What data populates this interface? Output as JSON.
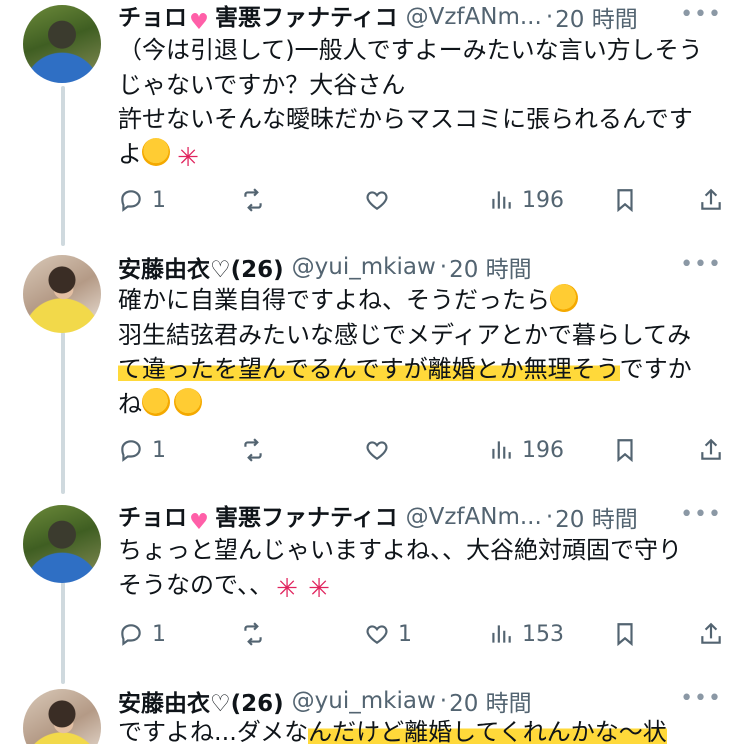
{
  "tweets": [
    {
      "name": "チョロ",
      "name_suffix": "害悪ファナティコ",
      "handle": "@VzfANm...",
      "time": "20 時間",
      "more": "•••",
      "lines": [
        "（今は引退して)一般人ですよーみたいな言い方しそう",
        "じゃないですか？大谷さん",
        "許せないそんな曖昧だからマスコミに張られるんです",
        "よ"
      ],
      "replies": "1",
      "retweets": "",
      "likes": "",
      "views": "196"
    },
    {
      "name": "安藤由衣♡(26)",
      "handle": "@yui_mkiaw",
      "time": "20 時間",
      "more": "•••",
      "line1": "確かに自業自得ですよね、そうだったら",
      "line2": "羽生結弦君みたいな感じでメディアとかで暮らしてみ",
      "line3_hl": "て違ったを望んでるんですが離婚とか無理そう",
      "line3_rest": "ですか",
      "line4": "ね",
      "replies": "1",
      "retweets": "",
      "likes": "",
      "views": "196"
    },
    {
      "name": "チョロ",
      "name_suffix": "害悪ファナティコ",
      "handle": "@VzfANm...",
      "time": "20 時間",
      "more": "•••",
      "lines": [
        "ちょっと望んじゃいますよね、、大谷絶対頑固で守り",
        "そうなので、、"
      ],
      "replies": "1",
      "retweets": "",
      "likes": "1",
      "views": "153"
    },
    {
      "name": "安藤由衣♡(26)",
      "handle": "@yui_mkiaw",
      "time": "20 時間",
      "more": "•••",
      "line1_plain": "ですよね...ダメな",
      "line1_hl": "んだけど離婚してくれんかな〜状"
    }
  ],
  "colors": {
    "highlight": "#ffd93a",
    "muted": "#536471",
    "thread": "#cfd9de"
  },
  "icons": [
    "reply-icon",
    "retweet-icon",
    "like-icon",
    "views-icon",
    "bookmark-icon",
    "share-icon"
  ]
}
